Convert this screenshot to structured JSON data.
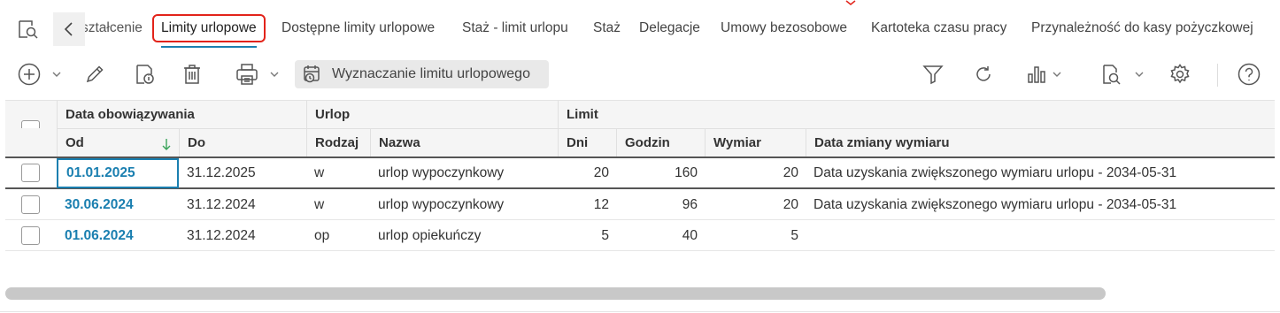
{
  "tabs": [
    {
      "label": "Wykształcenie"
    },
    {
      "label": "Limity urlopowe"
    },
    {
      "label": "Dostępne limity urlopowe"
    },
    {
      "label": "Staż - limit urlopu"
    },
    {
      "label": "Staż"
    },
    {
      "label": "Delegacje"
    },
    {
      "label": "Umowy bezosobowe"
    },
    {
      "label": "Kartoteka czasu pracy"
    },
    {
      "label": "Przynależność do kasy pożyczkowej"
    }
  ],
  "active_tab": "Limity urlopowe",
  "toolbar": {
    "limit_button_label": "Wyznaczanie limitu urlopowego",
    "icons": [
      "add-icon",
      "edit-icon",
      "details-icon",
      "delete-icon",
      "print-icon",
      "filter-icon",
      "refresh-icon",
      "chart-icon",
      "preview-icon",
      "settings-icon",
      "help-icon"
    ]
  },
  "grid": {
    "groups": {
      "validity": "Data obowiązywania",
      "leave": "Urlop",
      "limit": "Limit"
    },
    "columns": {
      "od": "Od",
      "do": "Do",
      "rodzaj": "Rodzaj",
      "nazwa": "Nazwa",
      "dni": "Dni",
      "godzin": "Godzin",
      "wymiar": "Wymiar",
      "data_zmiany": "Data zmiany wymiaru"
    },
    "rows": [
      {
        "od": "01.01.2025",
        "do": "31.12.2025",
        "rodzaj": "w",
        "nazwa": "urlop wypoczynkowy",
        "dni": "20",
        "godzin": "160",
        "wymiar": "20",
        "data_zmiany": "Data uzyskania zwiększonego wymiaru urlopu - 2034-05-31"
      },
      {
        "od": "30.06.2024",
        "do": "31.12.2024",
        "rodzaj": "w",
        "nazwa": "urlop wypoczynkowy",
        "dni": "12",
        "godzin": "96",
        "wymiar": "20",
        "data_zmiany": "Data uzyskania zwiększonego wymiaru urlopu - 2034-05-31"
      },
      {
        "od": "01.06.2024",
        "do": "31.12.2024",
        "rodzaj": "op",
        "nazwa": "urlop opiekuńczy",
        "dni": "5",
        "godzin": "40",
        "wymiar": "5",
        "data_zmiany": ""
      }
    ]
  },
  "colors": {
    "accent": "#1a7fb0",
    "highlight_border": "#e2231a"
  }
}
